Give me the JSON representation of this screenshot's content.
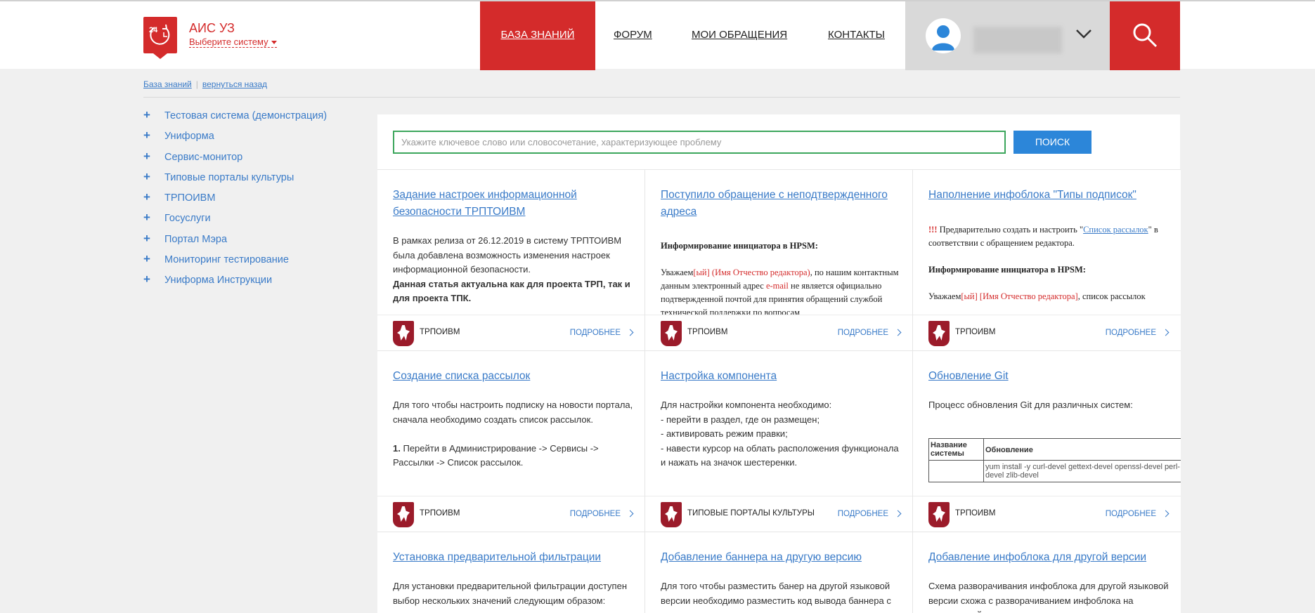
{
  "brand": {
    "title": "АИС УЗ",
    "select_label": "Выберите систему",
    "logo_number": "24"
  },
  "nav": {
    "items": [
      {
        "label": "БАЗА ЗНАНИЙ"
      },
      {
        "label": "ФОРУМ"
      },
      {
        "label": "МОИ ОБРАЩЕНИЯ"
      },
      {
        "label": "КОНТАКТЫ"
      }
    ]
  },
  "breadcrumb": {
    "home": "База знаний",
    "back": "вернуться назад"
  },
  "sidebar": {
    "items": [
      {
        "label": "Тестовая система (демонстрация)"
      },
      {
        "label": "Униформа"
      },
      {
        "label": "Сервис-монитор"
      },
      {
        "label": "Типовые порталы культуры"
      },
      {
        "label": "ТРПОИВМ"
      },
      {
        "label": "Госуслуги"
      },
      {
        "label": "Портал Мэра"
      },
      {
        "label": "Мониторинг тестирование"
      },
      {
        "label": "Униформа Инструкции"
      }
    ]
  },
  "search": {
    "placeholder": "Укажите ключевое слово или словосочетание, характеризующее проблему",
    "button": "ПОИСК"
  },
  "more_label": "ПОДРОБНЕЕ",
  "cards": [
    {
      "title": "Задание настроек информационной безопасности ТРПТОИВМ",
      "body": "В рамках релиза от 26.12.2019 в систему ТРПТОИВМ была добавлена возможность изменения настроек информационной безопасности.",
      "body_bold": "Данная статья актуальна как для проекта ТРП, так и для проекта ТПК.",
      "system": "ТРПОИВМ"
    },
    {
      "title": "Поступило обращение с неподтвержденного адреса",
      "heading": "Информирование инициатора в HPSM",
      "p1": "Уважаем",
      "p1_red1": "[ый]",
      "p1_red2": "(Имя Отчество редактора)",
      "p1_rest": ", по нашим контактным данным электронный адрес",
      "p1_red3": "e-mail",
      "p1_rest2": "не является официально подтвержденной почтой для принятия обращений службой технической поддержки по вопросам",
      "system": "ТРПОИВМ"
    },
    {
      "title": "Наполнение инфоблока \"Типы подписок\"",
      "warn": "!!!",
      "p1_a": "Предварительно создать и настроить \"",
      "p1_link": "Список рассылок",
      "p1_b": "\" в соответствии с обращением редактора.",
      "heading": "Информирование инициатора в HPSM:",
      "p2_a": "Уважаем",
      "p2_red1": "[ый]",
      "p2_red2": "[Имя Отчество редактора]",
      "p2_b": ", список рассылок",
      "system": "ТРПОИВМ"
    },
    {
      "title": "Создание списка рассылок",
      "body": "Для того чтобы настроить подписку на новости портала, сначала необходимо создать список рассылок.",
      "step_num": "1.",
      "step": "Перейти в Администрирование -> Сервисы -> Рассылки -> Список рассылок.",
      "system": "ТРПОИВМ"
    },
    {
      "title": "Настройка компонента",
      "lines": [
        "Для настройки компонента необходимо:",
        "- перейти в раздел, где он размещен;",
        "- активировать режим правки;",
        "- навести курсор на облать расположения функционала и нажать на значок шестеренки."
      ],
      "system": "ТИПОВЫЕ ПОРТАЛЫ КУЛЬТУРЫ"
    },
    {
      "title": "Обновление Git",
      "body": "Процесс обновления Git для различных систем:",
      "table": {
        "col1": "Название системы",
        "col2": "Обновление",
        "cmd": "yum install -y curl-devel gettext-devel openssl-devel perl-devel zlib-devel"
      },
      "system": "ТРПОИВМ"
    },
    {
      "title": "Установка предварительной фильтрации",
      "body": "Для установки предварительной фильтрации доступен выбор нескольких значений следующим образом:"
    },
    {
      "title": "Добавление баннера на другую версию",
      "body": "Для того чтобы разместить банер на другой языковой версии необходимо разместить код вывода баннера с определенным уникальным для"
    },
    {
      "title": "Добавление инфоблока для другой версии",
      "body": "Схема разворачивания инфоблока для другой языковой версии схожа с разворачиванием инфоблока на стандартной версии."
    }
  ]
}
